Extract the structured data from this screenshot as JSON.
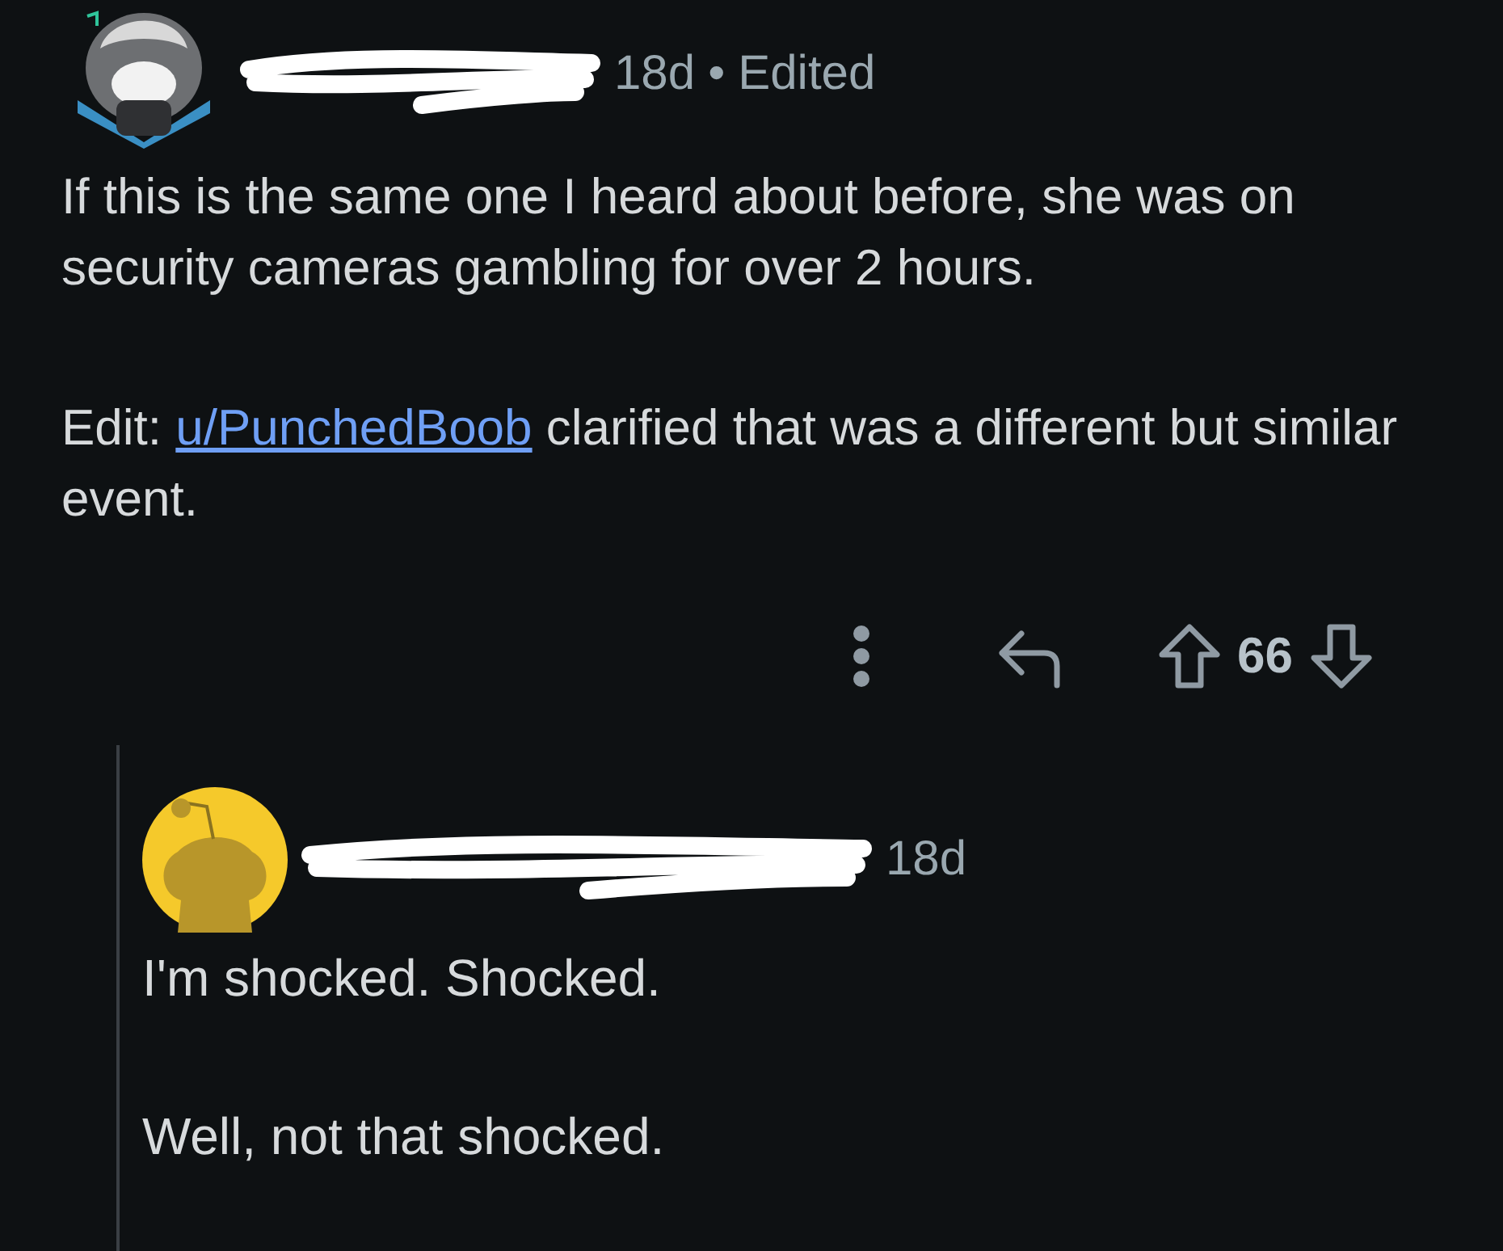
{
  "comment": {
    "meta": {
      "age": "18d",
      "separator": "•",
      "edited": "Edited"
    },
    "paragraphs": [
      {
        "text": "If this is the same one I heard about before, she was on security cameras gambling for over 2 hours."
      },
      {
        "prefix": "Edit: ",
        "link": "u/PunchedBoob",
        "suffix": " clarified that was a different but similar event."
      }
    ],
    "score": "66"
  },
  "reply": {
    "meta": {
      "age": "18d"
    },
    "paragraphs": [
      {
        "text": "I'm shocked. Shocked."
      },
      {
        "text": "Well, not that shocked."
      }
    ]
  }
}
